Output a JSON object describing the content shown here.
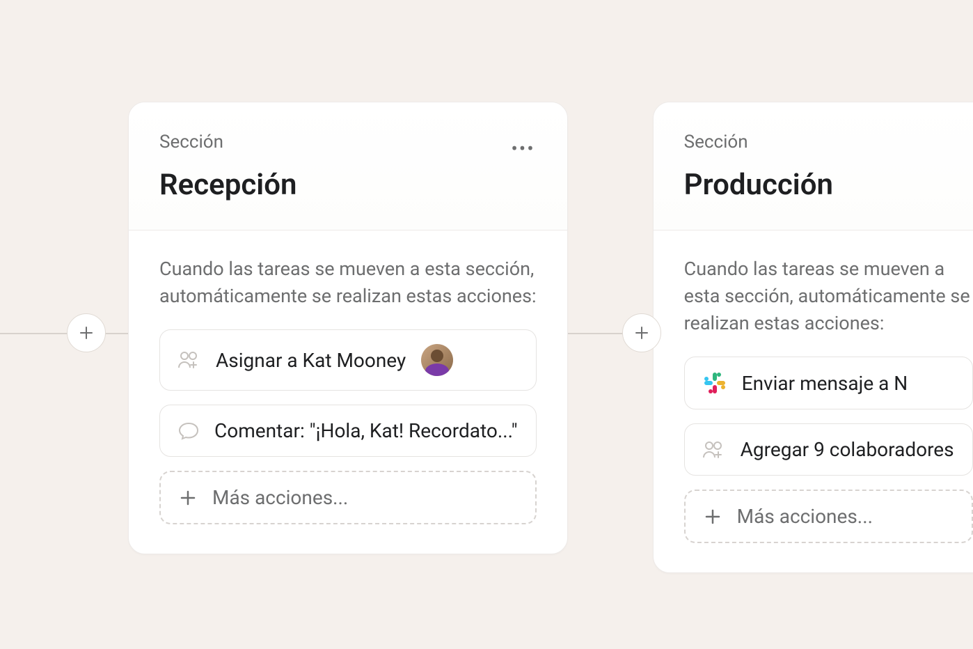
{
  "section_label": "Sección",
  "cards": {
    "left": {
      "title": "Recepción",
      "description": "Cuando las tareas se mueven a esta sección, automáticamente se realizan estas acciones:",
      "actions": [
        {
          "icon": "assign",
          "text": "Asignar a Kat Mooney",
          "avatar": true
        },
        {
          "icon": "comment",
          "text": "Comentar: \"¡Hola, Kat! Recordato...\""
        }
      ],
      "more_actions": "Más acciones..."
    },
    "right": {
      "title": "Producción",
      "description": "Cuando las tareas se mueven a esta sección, automáticamente se realizan estas acciones:",
      "actions": [
        {
          "icon": "slack",
          "text": "Enviar mensaje a N"
        },
        {
          "icon": "collab",
          "text": "Agregar 9 colaboradores"
        }
      ],
      "more_actions": "Más acciones..."
    }
  }
}
